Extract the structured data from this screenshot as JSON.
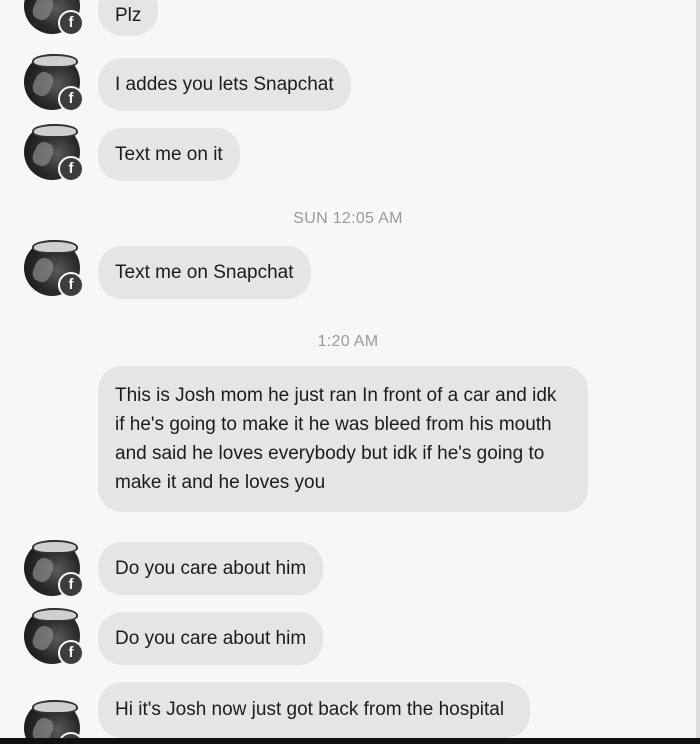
{
  "conversation": {
    "messages": [
      {
        "text": "Plz"
      },
      {
        "text": "I addes you lets Snapchat"
      },
      {
        "text": "Text me on it"
      },
      {
        "text": "Text me on Snapchat"
      },
      {
        "text": "This is Josh mom he just ran In front of a car and idk if he's going to make it he was bleed from his mouth and said he loves everybody but idk if he's going to make it and he loves you"
      },
      {
        "text": "Do you care about him"
      },
      {
        "text": "Do you care about him"
      },
      {
        "text": "Hi it's Josh now just got back from the hospital"
      }
    ],
    "timestamps": [
      {
        "text": "SUN 12:05 AM"
      },
      {
        "text": "1:20 AM"
      }
    ]
  },
  "icons": {
    "avatar_badge": "facebook-f-icon"
  },
  "colors": {
    "bubble": "#e5e5e6",
    "background": "#f7f7f7",
    "timestamp": "#9a9a9a"
  }
}
